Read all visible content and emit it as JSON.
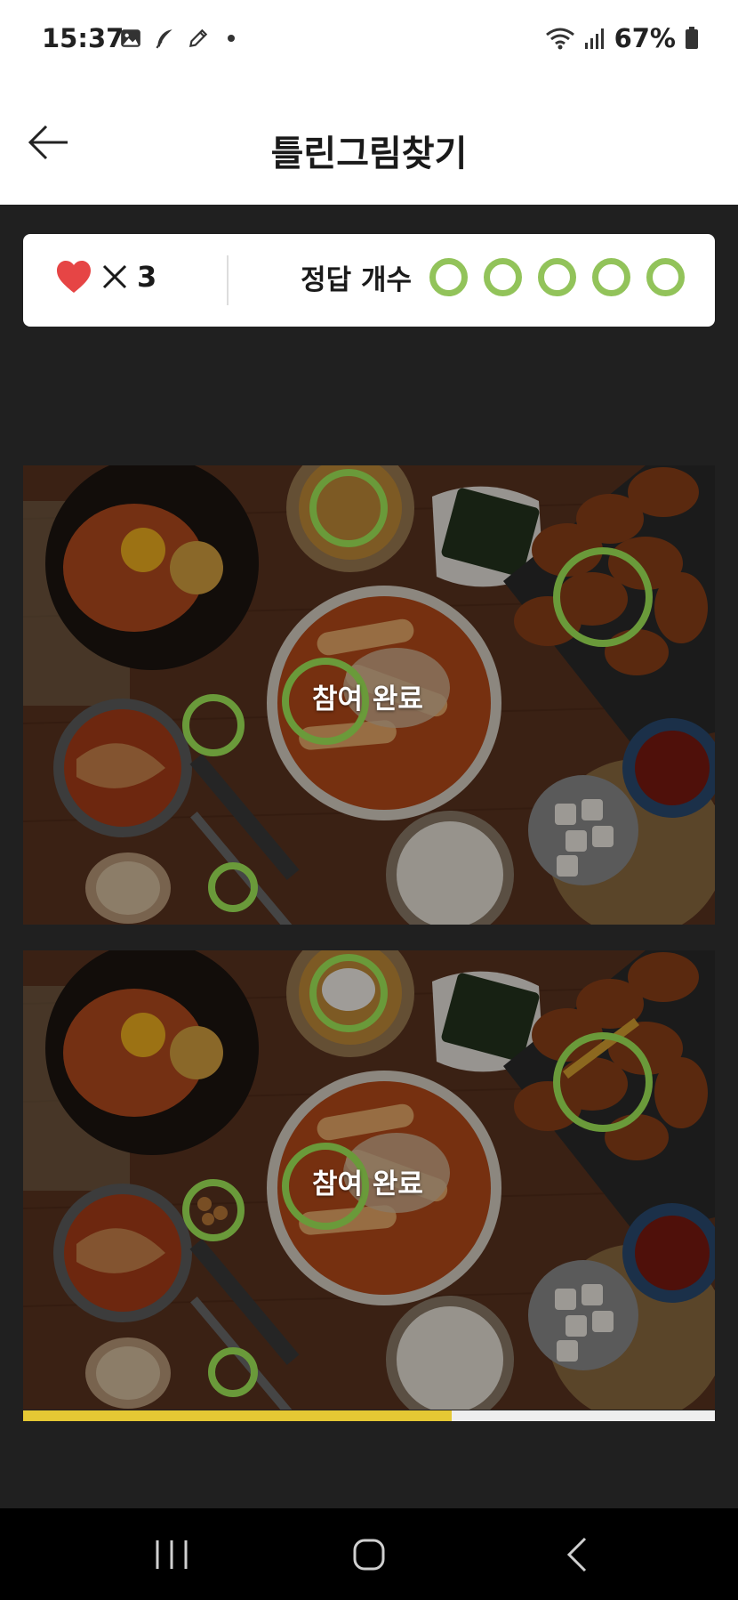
{
  "status_bar": {
    "time": "15:37",
    "battery": "67%",
    "icons": [
      "image-icon",
      "feather-icon",
      "pencil-icon",
      "wifi-icon",
      "signal-icon",
      "battery-icon"
    ]
  },
  "header": {
    "title": "틀린그림찾기",
    "back_icon": "arrow-left-icon"
  },
  "score_card": {
    "lives_count": "3",
    "lives_icon": "heart-icon",
    "answers_label": "정답 개수",
    "answers_total": 5,
    "answer_color": "#92c35a"
  },
  "puzzles": [
    {
      "overlay_label": "참여 완료"
    },
    {
      "overlay_label": "참여 완료"
    }
  ],
  "progress": {
    "fraction": 0.62,
    "color": "#e5c834"
  },
  "nav_bar": {
    "buttons": [
      "recent-apps-icon",
      "home-icon",
      "back-icon"
    ]
  },
  "colors": {
    "game_background": "#202020",
    "marker": "#6a9a3a"
  }
}
